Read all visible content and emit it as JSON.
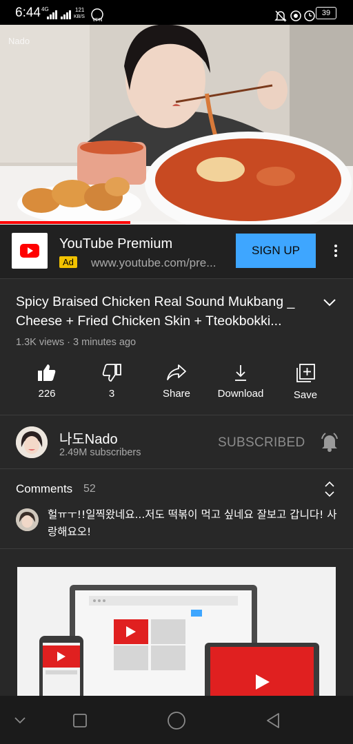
{
  "status_bar": {
    "time": "6:44",
    "network": "4G",
    "speed": "121",
    "speed_unit": "KB/S",
    "vpn": "VPN",
    "battery": "39"
  },
  "video": {
    "watermark": "Nado",
    "progress": 0.37
  },
  "ad": {
    "title": "YouTube Premium",
    "badge": "Ad",
    "url": "www.youtube.com/pre...",
    "cta": "SIGN UP",
    "logo_icon": "youtube-logo-icon"
  },
  "details": {
    "title": "Spicy Braised Chicken Real Sound Mukbang _ Cheese + Fried Chicken Skin + Tteokbokki...",
    "meta": "1.3K views · 3 minutes ago"
  },
  "actions": [
    {
      "label": "226",
      "icon": "like-icon"
    },
    {
      "label": "3",
      "icon": "dislike-icon"
    },
    {
      "label": "Share",
      "icon": "share-icon"
    },
    {
      "label": "Download",
      "icon": "download-icon"
    },
    {
      "label": "Save",
      "icon": "save-icon"
    }
  ],
  "channel": {
    "name": "나도Nado",
    "subscribers": "2.49M subscribers",
    "subscribe_state": "SUBSCRIBED"
  },
  "comments": {
    "label": "Comments",
    "count": "52",
    "top_comment": "헐ㅠㅜ!!일찍왔네요...저도 떡볶이 먹고 싶네요 잘보고 갑니다! 사랑해요오!"
  },
  "colors": {
    "accent_red": "#ff0000",
    "signup_blue": "#3ea6ff",
    "ad_badge": "#f2c200",
    "background": "#282828"
  }
}
